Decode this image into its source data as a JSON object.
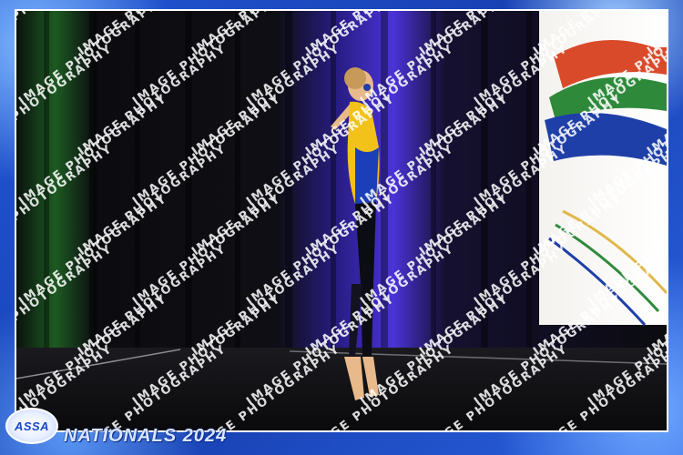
{
  "photo": {
    "description_subject": "gymnast on stage",
    "colors": {
      "curtain": "#0d0d12",
      "light_blue": "#5a3cff",
      "light_green": "#2fbf3a",
      "leotard_yellow": "#f2c21a",
      "leotard_blue": "#1a3fb8"
    }
  },
  "watermark": {
    "text": "IMAGE PHOTOGRAPHY"
  },
  "logo": {
    "text": "ASSA"
  },
  "event": {
    "title": "NATIONALS 2024"
  }
}
